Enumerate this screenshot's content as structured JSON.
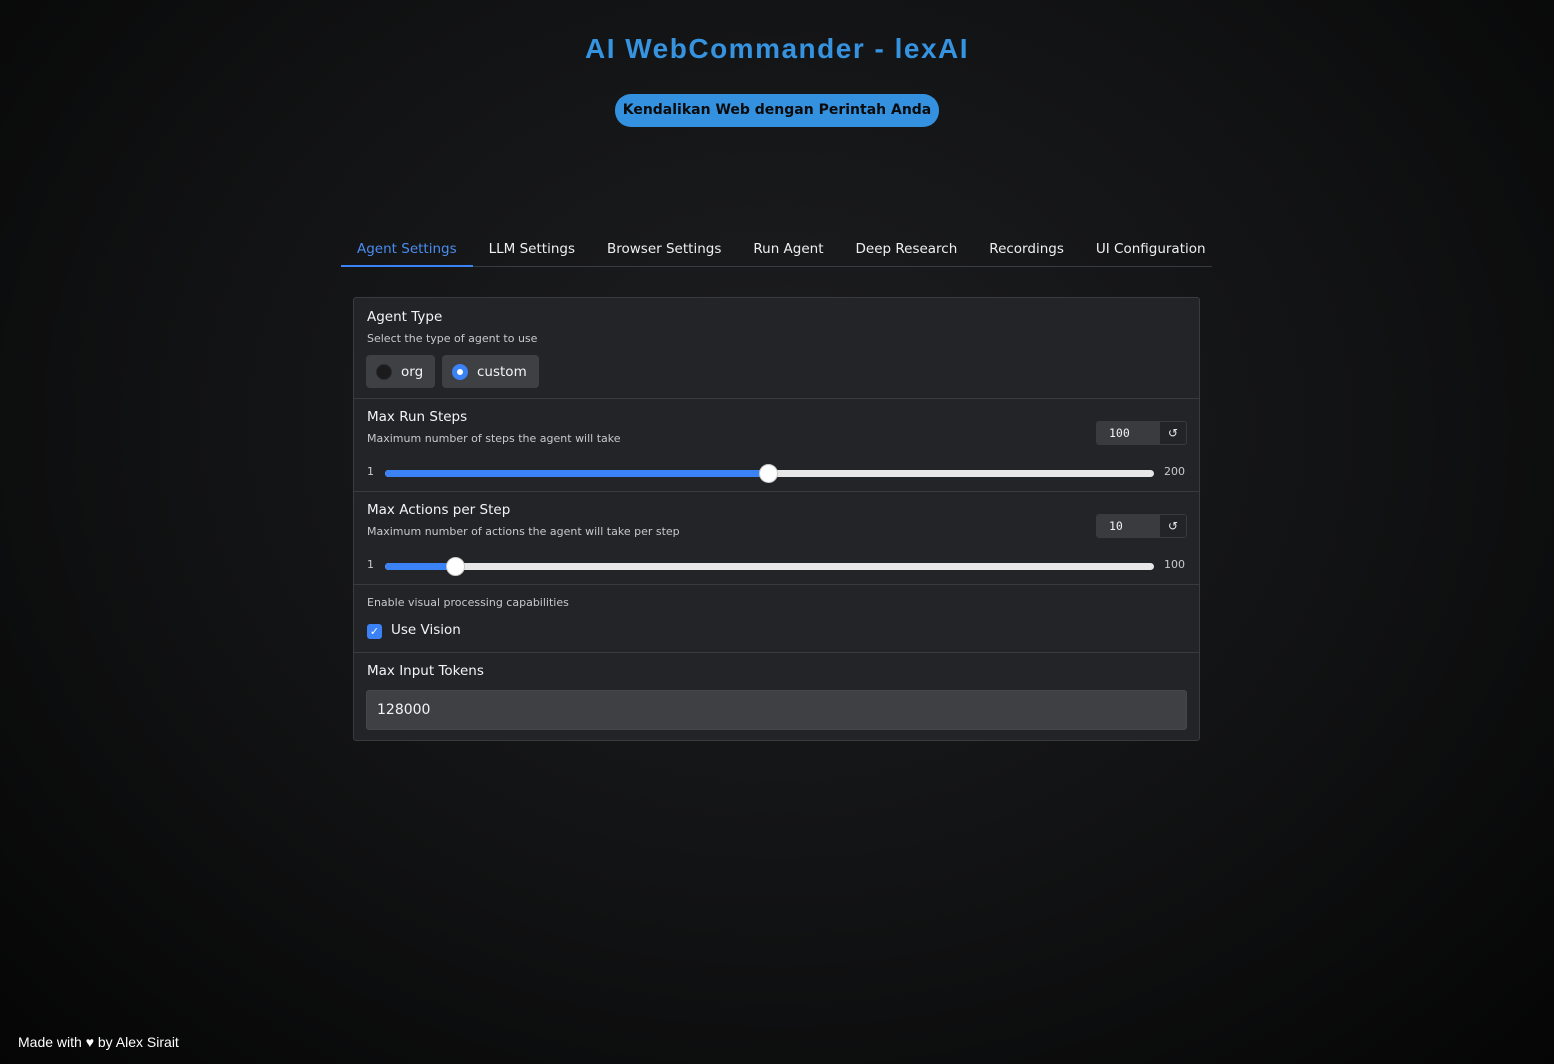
{
  "header": {
    "title": "AI WebCommander - lexAI",
    "subtitle": "Kendalikan Web dengan Perintah Anda"
  },
  "tabs": [
    {
      "label": "Agent Settings",
      "active": true
    },
    {
      "label": "LLM Settings"
    },
    {
      "label": "Browser Settings"
    },
    {
      "label": "Run Agent"
    },
    {
      "label": "Deep Research"
    },
    {
      "label": "Recordings"
    },
    {
      "label": "UI Configuration"
    }
  ],
  "agent_type": {
    "label": "Agent Type",
    "info": "Select the type of agent to use",
    "options": [
      "org",
      "custom"
    ],
    "selected": "custom"
  },
  "max_run_steps": {
    "label": "Max Run Steps",
    "info": "Maximum number of steps the agent will take",
    "value": "100",
    "min": "1",
    "max": "200",
    "reset_icon": "↺"
  },
  "max_actions": {
    "label": "Max Actions per Step",
    "info": "Maximum number of actions the agent will take per step",
    "value": "10",
    "min": "1",
    "max": "100",
    "reset_icon": "↺"
  },
  "vision": {
    "info": "Enable visual processing capabilities",
    "label": "Use Vision",
    "checked": true,
    "check_icon": "✓"
  },
  "max_input_tokens": {
    "label": "Max Input Tokens",
    "value": "128000"
  },
  "footer": {
    "text": "Made with ♥ by Alex Sirait"
  },
  "colors": {
    "accent": "#3b82f6",
    "title": "#3593e0",
    "panel": "#232427"
  }
}
